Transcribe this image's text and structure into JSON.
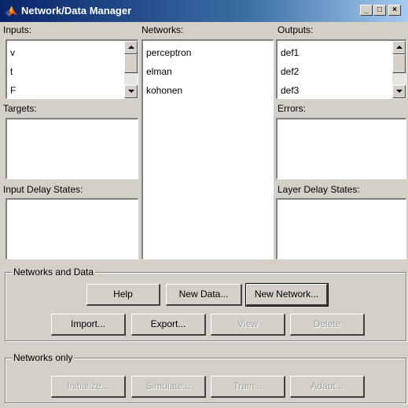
{
  "window": {
    "title": "Network/Data Manager"
  },
  "labels": {
    "inputs": "Inputs:",
    "networks": "Networks:",
    "outputs": "Outputs:",
    "targets": "Targets:",
    "errors": "Errors:",
    "input_delay_states": "Input Delay States:",
    "layer_delay_states": "Layer Delay States:"
  },
  "inputs": [
    "v",
    "t",
    "F"
  ],
  "networks": [
    "perceptron",
    "elman",
    "kohonen"
  ],
  "outputs": [
    "def1",
    "def2",
    "def3"
  ],
  "group_networks_and_data": {
    "title": "Networks and Data",
    "help": "Help",
    "new_data": "New Data...",
    "new_network": "New Network...",
    "import": "Import...",
    "export": "Export...",
    "view": "View",
    "delete": "Delete"
  },
  "group_networks_only": {
    "title": "Networks only",
    "initialize": "Initialize...",
    "simulate": "Simulate...",
    "train": "Train...",
    "adapt": "Adapt..."
  },
  "colors": {
    "titlebar_start": "#0a246a",
    "titlebar_end": "#a6caf0",
    "face": "#d4d0c8",
    "disabled_text": "#a0a0a0"
  }
}
